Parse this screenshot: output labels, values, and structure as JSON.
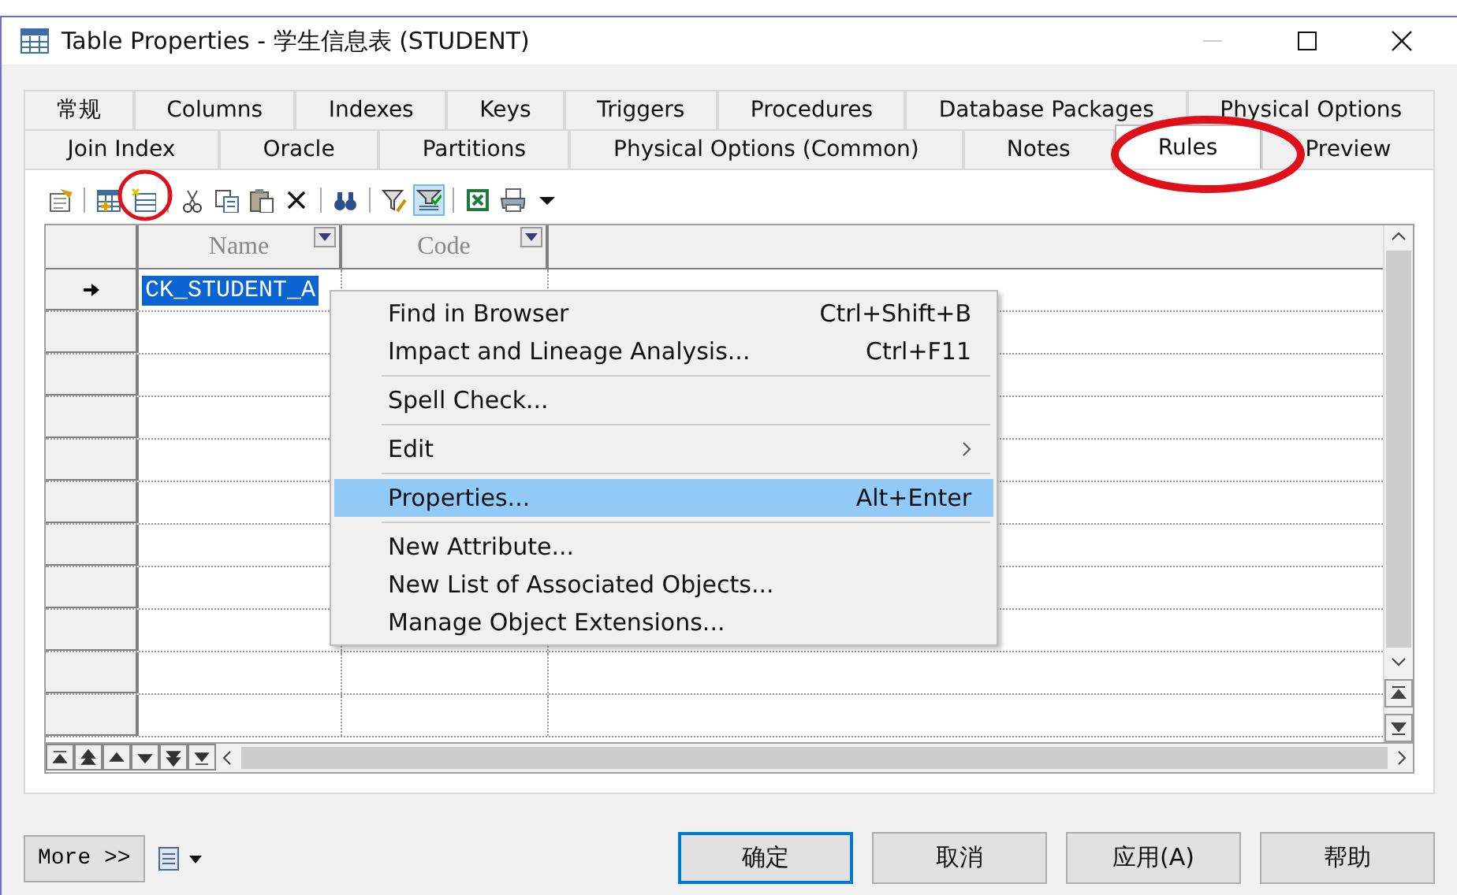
{
  "window": {
    "title": "Table Properties - 学生信息表 (STUDENT)"
  },
  "tab_rows": [
    [
      {
        "label": "常规",
        "selected": false
      },
      {
        "label": "Columns",
        "selected": false
      },
      {
        "label": "Indexes",
        "selected": false
      },
      {
        "label": "Keys",
        "selected": false
      },
      {
        "label": "Triggers",
        "selected": false
      },
      {
        "label": "Procedures",
        "selected": false
      },
      {
        "label": "Database Packages",
        "selected": false
      },
      {
        "label": "Physical Options",
        "selected": false
      }
    ],
    [
      {
        "label": "Join Index",
        "selected": false
      },
      {
        "label": "Oracle",
        "selected": false
      },
      {
        "label": "Partitions",
        "selected": false
      },
      {
        "label": "Physical Options (Common)",
        "selected": false
      },
      {
        "label": "Notes",
        "selected": false
      },
      {
        "label": "Rules",
        "selected": true
      },
      {
        "label": "Preview",
        "selected": false
      }
    ]
  ],
  "toolbar": [
    {
      "kind": "properties",
      "pressed": false
    },
    {
      "kind": "sep"
    },
    {
      "kind": "add-rows",
      "pressed": false
    },
    {
      "kind": "insert-row",
      "pressed": false
    },
    {
      "kind": "sep"
    },
    {
      "kind": "cut",
      "pressed": false
    },
    {
      "kind": "copy",
      "pressed": false
    },
    {
      "kind": "paste",
      "pressed": false
    },
    {
      "kind": "delete",
      "pressed": false
    },
    {
      "kind": "sep"
    },
    {
      "kind": "find",
      "pressed": false
    },
    {
      "kind": "sep"
    },
    {
      "kind": "filter-edit",
      "pressed": false
    },
    {
      "kind": "filter",
      "pressed": true
    },
    {
      "kind": "sep"
    },
    {
      "kind": "spreadsheet",
      "pressed": false
    },
    {
      "kind": "printer",
      "pressed": false
    },
    {
      "kind": "caret",
      "pressed": false
    }
  ],
  "table": {
    "columns": [
      "Name",
      "Code"
    ],
    "rows": [
      {
        "name": "CK_STUDENT_A",
        "current": true,
        "selected": true
      }
    ]
  },
  "context_menu": [
    {
      "kind": "item",
      "label": "Find in Browser",
      "shortcut": "Ctrl+Shift+B",
      "selected": false
    },
    {
      "kind": "item",
      "label": "Impact and Lineage Analysis...",
      "shortcut": "Ctrl+F11",
      "selected": false
    },
    {
      "kind": "separator"
    },
    {
      "kind": "item",
      "label": "Spell Check...",
      "selected": false
    },
    {
      "kind": "separator"
    },
    {
      "kind": "submenu",
      "label": "Edit",
      "selected": false
    },
    {
      "kind": "separator"
    },
    {
      "kind": "item",
      "label": "Properties...",
      "shortcut": "Alt+Enter",
      "selected": true
    },
    {
      "kind": "separator"
    },
    {
      "kind": "item",
      "label": "New Attribute...",
      "selected": false
    },
    {
      "kind": "item",
      "label": "New List of Associated Objects...",
      "selected": false
    },
    {
      "kind": "item",
      "label": "Manage Object Extensions...",
      "selected": false
    }
  ],
  "footer": {
    "more_button": "More >>",
    "buttons": [
      {
        "label": "确定",
        "default": true
      },
      {
        "label": "取消",
        "default": false
      },
      {
        "label": "应用(A)",
        "default": false
      },
      {
        "label": "帮助",
        "default": false
      }
    ]
  }
}
